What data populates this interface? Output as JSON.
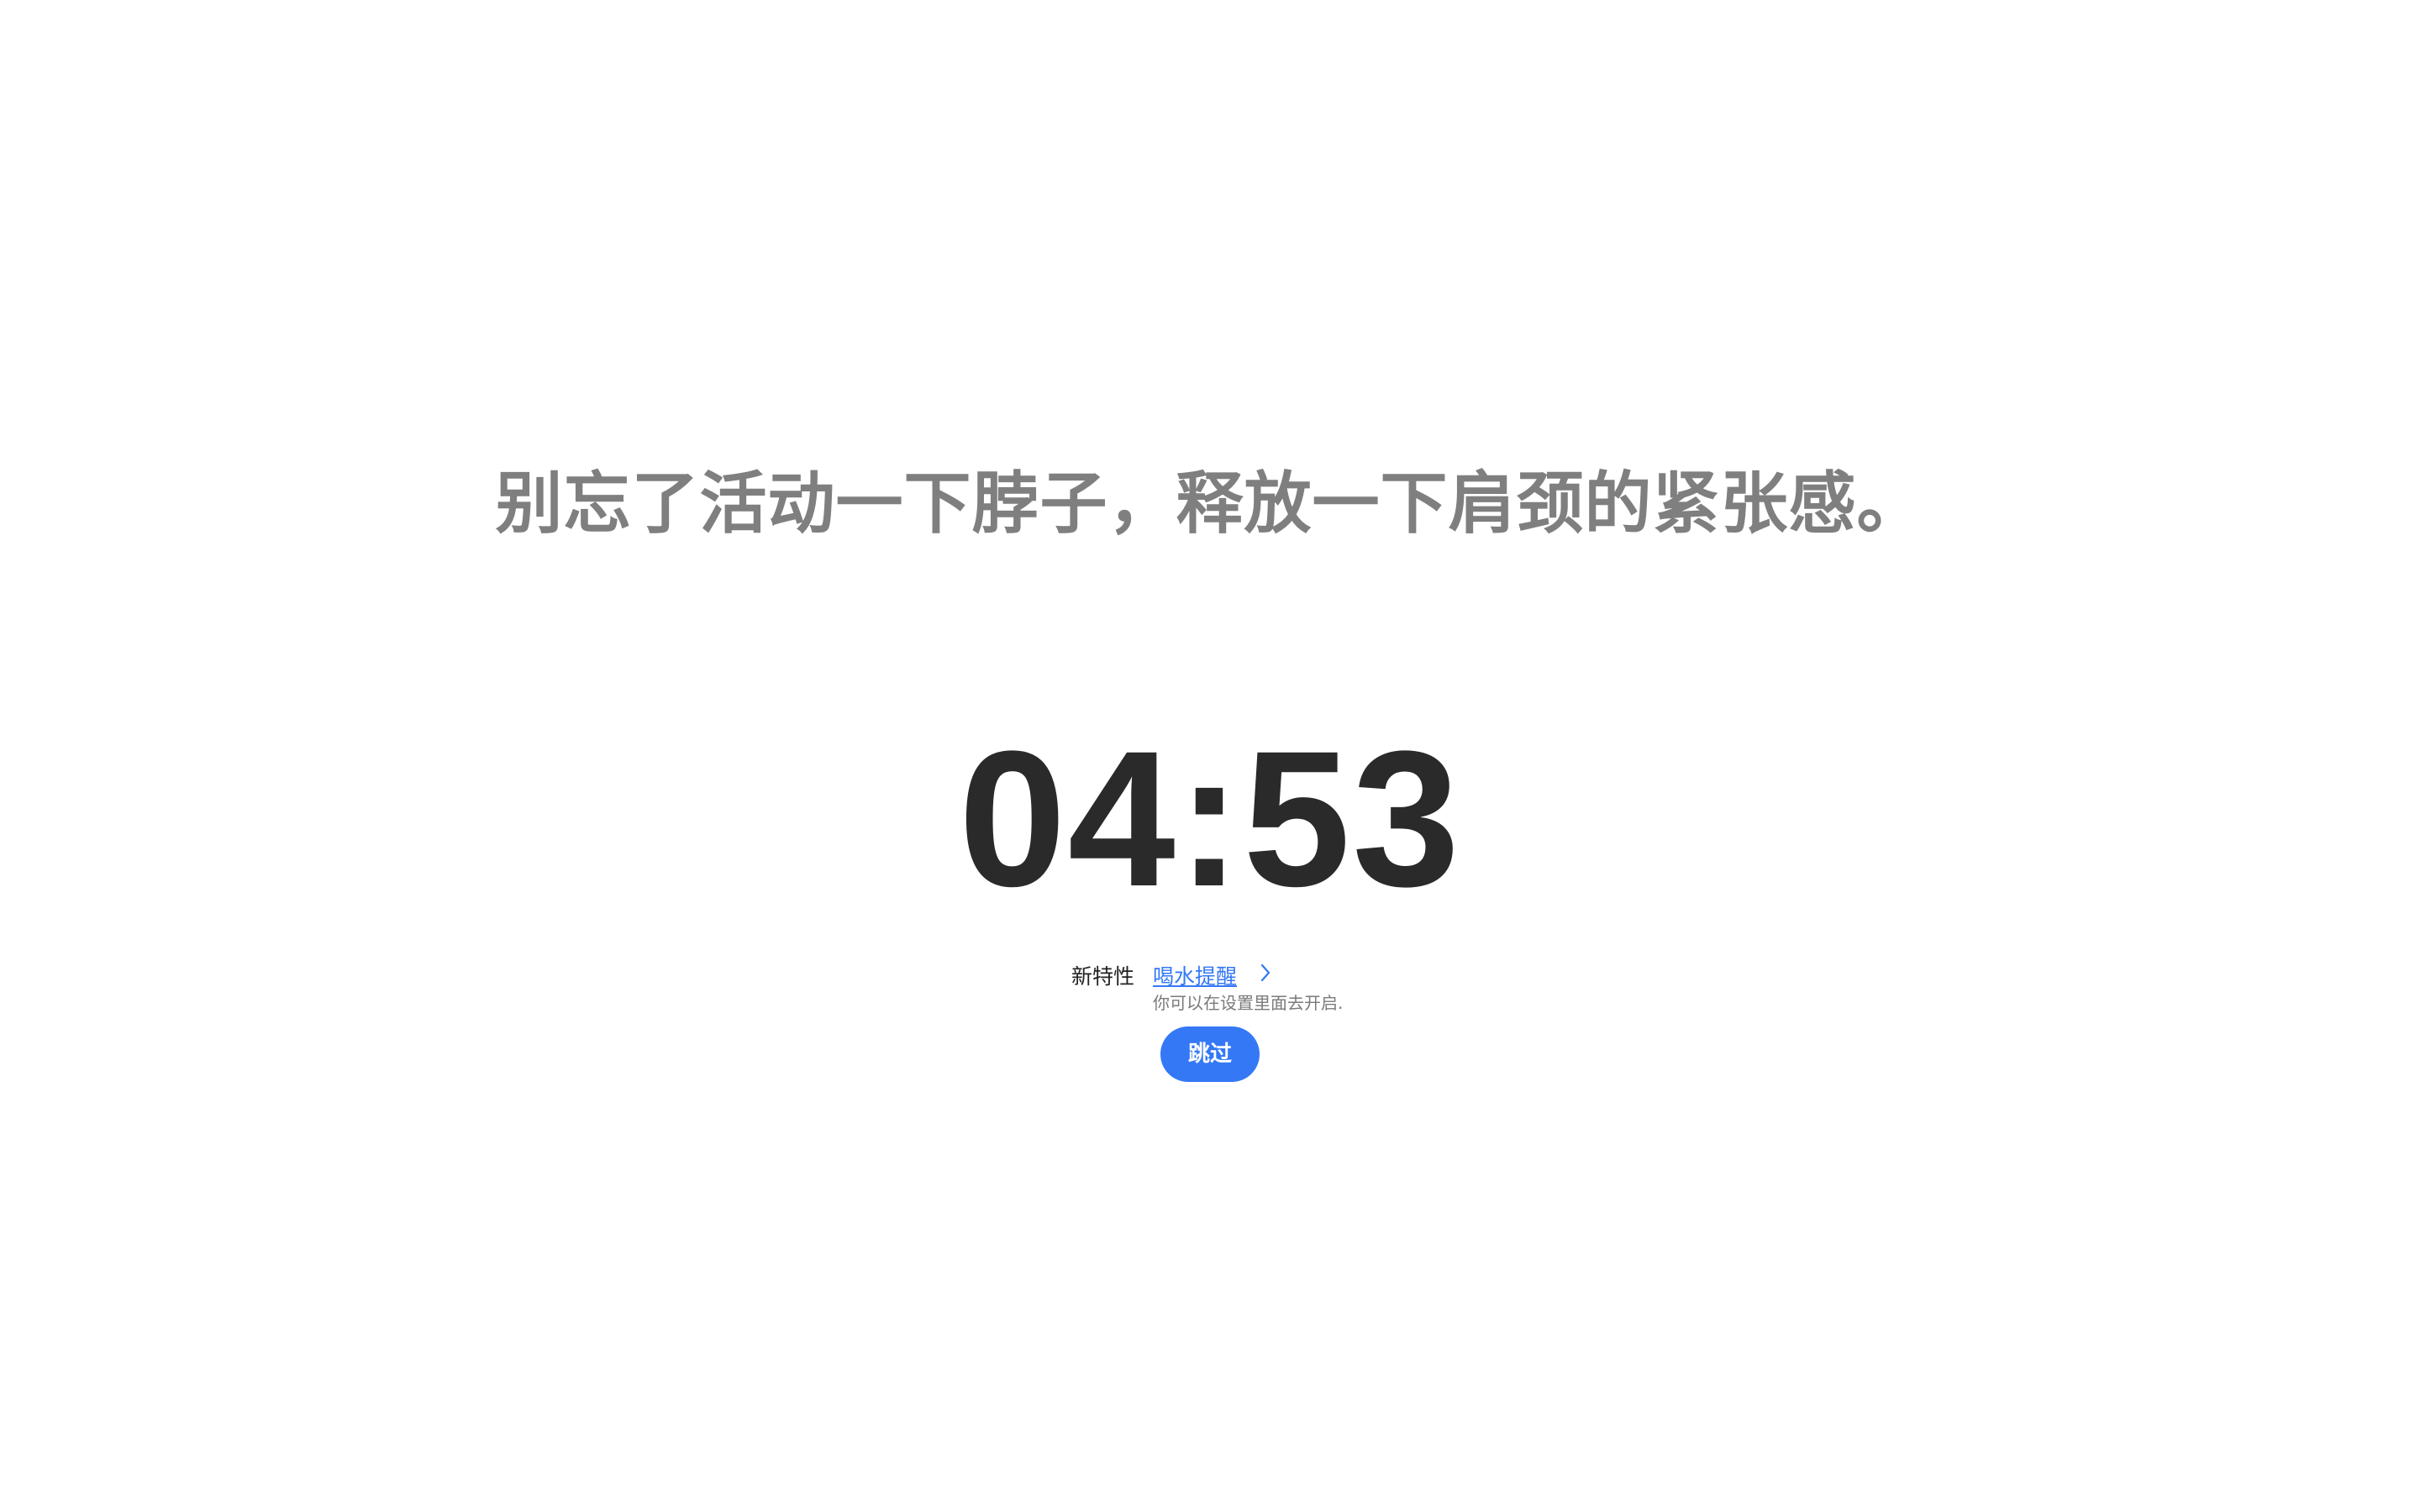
{
  "reminder": {
    "message": "别忘了活动一下脖子，释放一下肩颈的紧张感。",
    "countdown": "04:53"
  },
  "new_feature": {
    "tag": "新特性",
    "link_label": "喝水提醒",
    "link_icon": "chevron-right-icon",
    "hint": "你可以在设置里面去开启."
  },
  "actions": {
    "skip_label": "跳过"
  },
  "colors": {
    "background": "#ffffff",
    "message_text": "#7f7f7f",
    "countdown_text": "#2a2a2a",
    "accent": "#3478f6"
  }
}
